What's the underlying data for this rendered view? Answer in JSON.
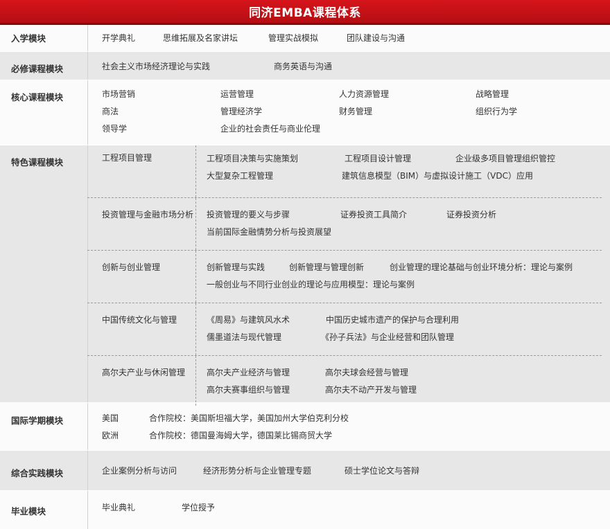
{
  "title": "同济EMBA课程体系",
  "modules": {
    "entry": {
      "label": "入学模块",
      "items": [
        "开学典礼",
        "思维拓展及名家讲坛",
        "管理实战模拟",
        "团队建设与沟通"
      ]
    },
    "required": {
      "label": "必修课程模块",
      "items": [
        "社会主义市场经济理论与实践",
        "商务英语与沟通"
      ]
    },
    "core": {
      "label": "核心课程模块",
      "rows": [
        [
          "市场营销",
          "运营管理",
          "人力资源管理",
          "战略管理"
        ],
        [
          "商法",
          "管理经济学",
          "财务管理",
          "组织行为学"
        ],
        [
          "领导学",
          "企业的社会责任与商业伦理"
        ]
      ]
    },
    "special": {
      "label": "特色课程模块",
      "groups": [
        {
          "name": "工程项目管理",
          "rows": [
            [
              "工程项目决策与实施策划",
              "工程项目设计管理",
              "企业级多项目管理组织管控"
            ],
            [
              "大型复杂工程管理",
              "建筑信息模型（BIM）与虚拟设计施工（VDC）应用"
            ]
          ]
        },
        {
          "name": "投资管理与金融市场分析",
          "rows": [
            [
              "投资管理的要义与步骤",
              "证券投资工具简介",
              "证券投资分析"
            ],
            [
              "当前国际金融情势分析与投资展望"
            ]
          ]
        },
        {
          "name": "创新与创业管理",
          "rows": [
            [
              "创新管理与实践",
              "创新管理与管理创新",
              "创业管理的理论基础与创业环境分析：理论与案例"
            ],
            [
              "一般创业与不同行业创业的理论与应用模型：理论与案例"
            ]
          ]
        },
        {
          "name": "中国传统文化与管理",
          "rows": [
            [
              "《周易》与建筑风水术",
              "中国历史城市遗产的保护与合理利用"
            ],
            [
              "儒墨道法与现代管理",
              "《孙子兵法》与企业经营和团队管理"
            ]
          ]
        },
        {
          "name": "高尔夫产业与休闲管理",
          "rows": [
            [
              "高尔夫产业经济与管理",
              "高尔夫球会经营与管理"
            ],
            [
              "高尔夫赛事组织与管理",
              "高尔夫不动产开发与管理"
            ]
          ]
        }
      ]
    },
    "international": {
      "label": "国际学期模块",
      "rows": [
        [
          "美国",
          "合作院校：美国斯坦福大学，美国加州大学伯克利分校"
        ],
        [
          "欧洲",
          "合作院校：德国曼海姆大学，德国莱比锡商贸大学"
        ]
      ]
    },
    "practice": {
      "label": "综合实践模块",
      "items": [
        "企业案例分析与访问",
        "经济形势分析与企业管理专题",
        "硕士学位论文与答辩"
      ]
    },
    "graduation": {
      "label": "毕业模块",
      "items": [
        "毕业典礼",
        "学位授予"
      ]
    }
  }
}
